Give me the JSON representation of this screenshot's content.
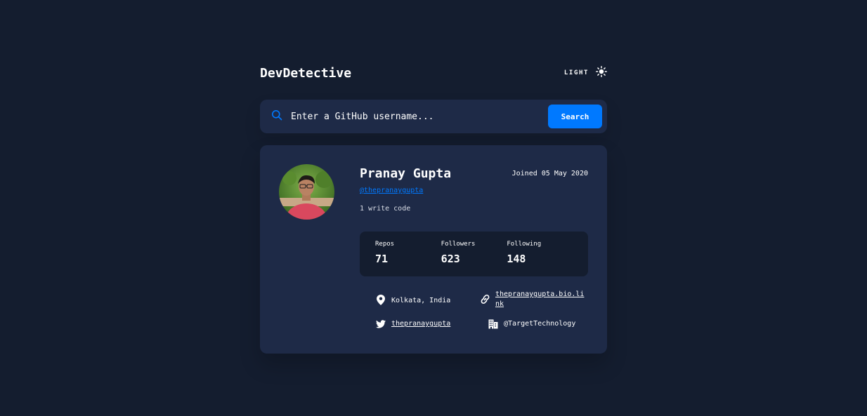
{
  "header": {
    "brand": "DevDetective",
    "theme_label": "LIGHT",
    "theme_icon": "sun-icon"
  },
  "search": {
    "placeholder": "Enter a GitHub username...",
    "button_label": "Search",
    "icon": "search-icon"
  },
  "profile": {
    "name": "Pranay Gupta",
    "login": "@thepranaygupta",
    "joined": "Joined 05 May 2020",
    "bio": "1 write code",
    "stats": {
      "repos_label": "Repos",
      "repos_value": "71",
      "followers_label": "Followers",
      "followers_value": "623",
      "following_label": "Following",
      "following_value": "148"
    },
    "links": {
      "location": "Kolkata, India",
      "website_line1": "thepranaygupta.bio.li",
      "website_line2": "nk",
      "twitter": "thepranaygupta",
      "company": "@TargetTechnology"
    }
  },
  "colors": {
    "background": "#141d2f",
    "card": "#1e2a47",
    "accent": "#0079ff",
    "text": "#ffffff"
  }
}
